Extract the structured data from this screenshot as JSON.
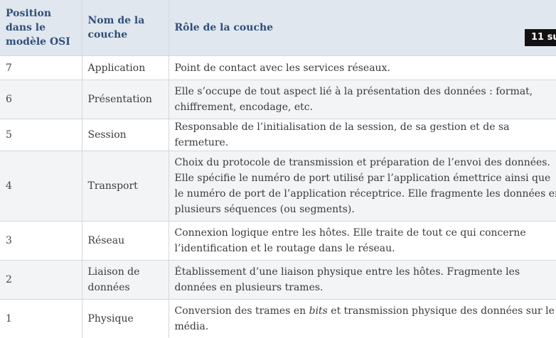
{
  "table": {
    "headers": {
      "position": "Position dans le modèle OSI",
      "name": "Nom de la couche",
      "role": "Rôle de la couche"
    },
    "rows": [
      {
        "position": "7",
        "name": "Application",
        "role": "Point de contact avec les services réseaux."
      },
      {
        "position": "6",
        "name": "Présentation",
        "role": "Elle s’occupe de tout aspect lié à la présentation des données : format, chiffrement, encodage, etc."
      },
      {
        "position": "5",
        "name": "Session",
        "role": "Responsable de l’initialisation de la session, de sa gestion et de sa fermeture."
      },
      {
        "position": "4",
        "name": "Transport",
        "role": "Choix du protocole de transmission et préparation de l’envoi des données. Elle spécifie le numéro de port utilisé par l’application émettrice ainsi que le numéro de port de l’application réceptrice. Elle fragmente les données en plusieurs séquences (ou segments)."
      },
      {
        "position": "3",
        "name": "Réseau",
        "role": "Connexion logique entre les hôtes. Elle traite de tout ce qui concerne l’identification et le routage dans le réseau."
      },
      {
        "position": "2",
        "name": "Liaison de données",
        "role": "Établissement d’une liaison physique entre les hôtes. Fragmente les données en plusieurs trames."
      },
      {
        "position": "1",
        "name": "Physique",
        "role_before": "Conversion des trames en ",
        "role_em": "bits",
        "role_after": " et transmission physique des données sur le média."
      }
    ]
  },
  "badge": {
    "text": "11 su"
  }
}
